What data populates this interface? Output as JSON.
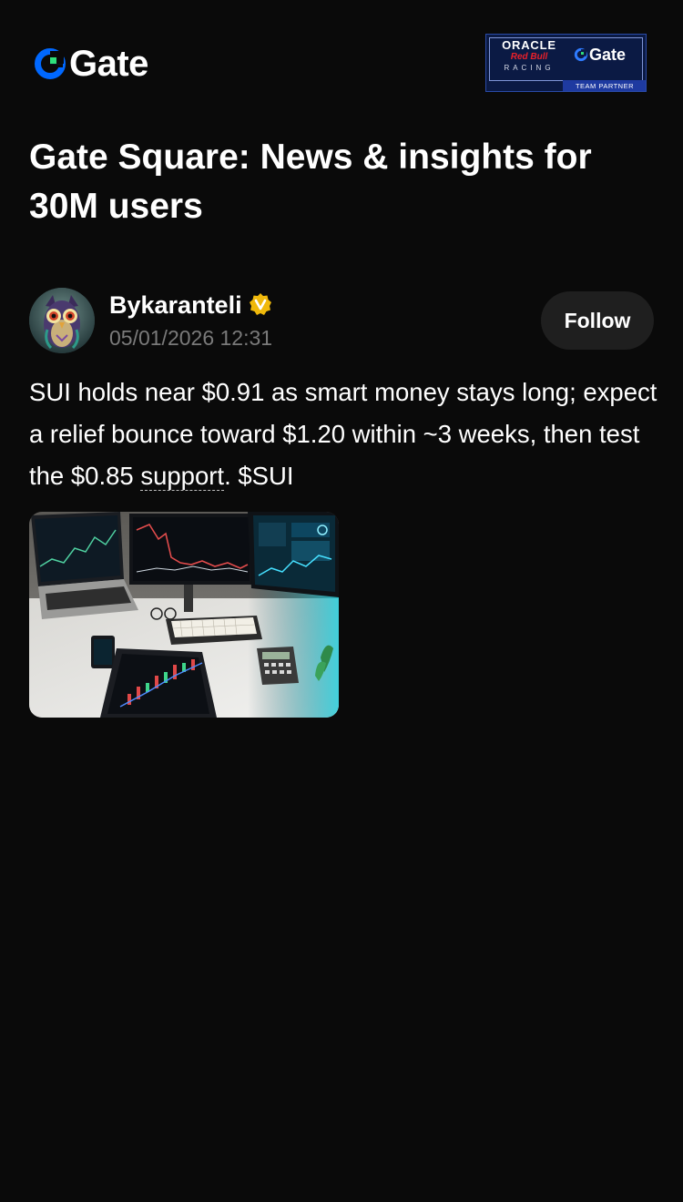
{
  "header": {
    "brand_name": "Gate",
    "brand_icon": "gate-logo-icon",
    "partner_badge": {
      "oracle": "ORACLE",
      "red_bull": "Red Bull",
      "racing": "RACING",
      "gate": "Gate",
      "team_partner": "TEAM PARTNER"
    }
  },
  "page_title": "Gate Square: News & insights for 30M users",
  "post": {
    "author": "Bykaranteli",
    "verified_icon": "verified-badge-icon",
    "timestamp": "05/01/2026 12:31",
    "follow_label": "Follow",
    "text_part1": "SUI holds near $0.91 as smart money stays long; expect a relief bounce toward $1.20 within ~3 weeks, then test the $0.85 ",
    "text_link": "support",
    "text_part2": ". ",
    "cashtag": "$SUI"
  },
  "colors": {
    "background": "#0a0a0a",
    "text_primary": "#ffffff",
    "text_secondary": "#7a7a7a",
    "button_bg": "#1f1f1f",
    "brand_blue": "#0068ff",
    "brand_green": "#2fe07b",
    "verified_gold": "#f0b90b"
  }
}
